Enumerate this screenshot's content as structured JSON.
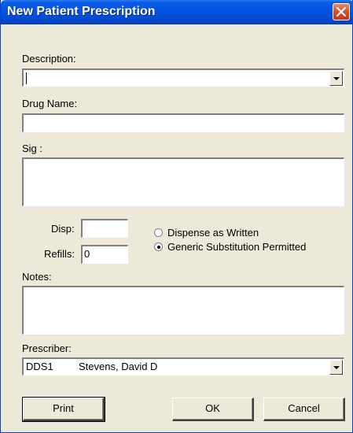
{
  "window": {
    "title": "New Patient Prescription"
  },
  "form": {
    "description": {
      "label": "Description:",
      "value": ""
    },
    "drug_name": {
      "label": "Drug Name:",
      "value": ""
    },
    "sig": {
      "label": "Sig :",
      "value": ""
    },
    "disp": {
      "label": "Disp:",
      "value": ""
    },
    "refills": {
      "label": "Refills:",
      "value": "0"
    },
    "substitution": {
      "options": [
        {
          "label": "Dispense as Written",
          "selected": false
        },
        {
          "label": "Generic Substitution Permitted",
          "selected": true
        }
      ]
    },
    "notes": {
      "label": "Notes:",
      "value": ""
    },
    "prescriber": {
      "label": "Prescriber:",
      "code": "DDS1",
      "name": "Stevens, David D"
    }
  },
  "buttons": {
    "print": "Print",
    "ok": "OK",
    "cancel": "Cancel"
  },
  "colors": {
    "titlebar": "#0552e0",
    "dialog_bg": "#ece9d8",
    "close_button": "#d44e2a"
  },
  "icons": {
    "close": "close-icon",
    "dropdown": "chevron-down-icon"
  }
}
